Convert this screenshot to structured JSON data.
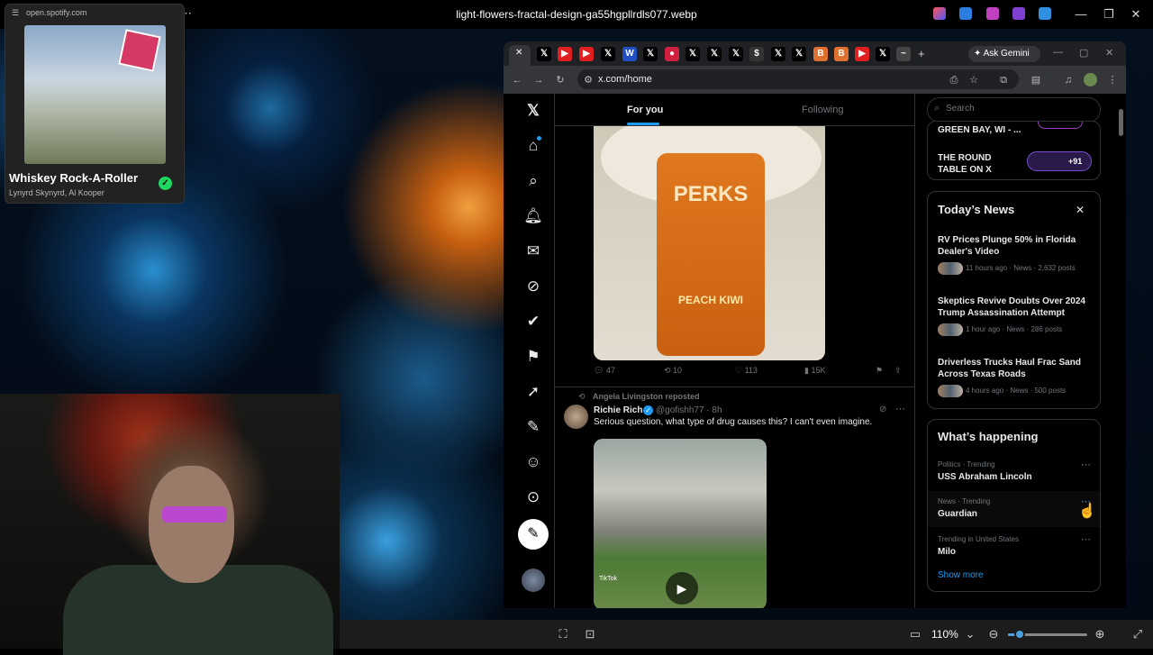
{
  "viewer": {
    "filename": "light-flowers-fractal-design-ga55hgpllrdls077.webp",
    "zoom": "110%",
    "zoom_fraction": 0.15
  },
  "spotify": {
    "url": "open.spotify.com",
    "track": "Whiskey Rock-A-Roller",
    "artists": "Lynyrd Skynyrd, Al Kooper"
  },
  "chrome": {
    "url": "x.com/home",
    "gemini_label": "Ask Gemini"
  },
  "x": {
    "tabs": {
      "for_you": "For you",
      "following": "Following"
    },
    "post1": {
      "brand": "PERKS",
      "flavor": "PEACH KIWI",
      "replies": "47",
      "reposts": "10",
      "likes": "113",
      "views": "15K"
    },
    "post2": {
      "reposted_by": "Angela Livingston reposted",
      "name": "Richie Rich",
      "handle": "@gofishh77 · 8h",
      "text": "Serious question, what type of drug causes this? I can't even imagine.",
      "video_watermark": "TikTok"
    },
    "search_placeholder": "Search",
    "live": [
      {
        "title": "GREEN BAY, WI - ..."
      },
      {
        "title": "THE ROUND TABLE ON X",
        "count": "+91"
      }
    ],
    "news": {
      "heading": "Today’s News",
      "items": [
        {
          "title": "RV Prices Plunge 50% in Florida Dealer's Video",
          "meta": "11 hours ago · News · 2,632 posts"
        },
        {
          "title": "Skeptics Revive Doubts Over 2024 Trump Assassination Attempt",
          "meta": "1 hour ago · News · 286 posts"
        },
        {
          "title": "Driverless Trucks Haul Frac Sand Across Texas Roads",
          "meta": "4 hours ago · News · 500 posts"
        }
      ]
    },
    "trending": {
      "heading": "What’s happening",
      "items": [
        {
          "category": "Politics · Trending",
          "name": "USS Abraham Lincoln"
        },
        {
          "category": "News · Trending",
          "name": "Guardian"
        },
        {
          "category": "Trending in United States",
          "name": "Milo"
        }
      ],
      "show_more": "Show more"
    }
  }
}
